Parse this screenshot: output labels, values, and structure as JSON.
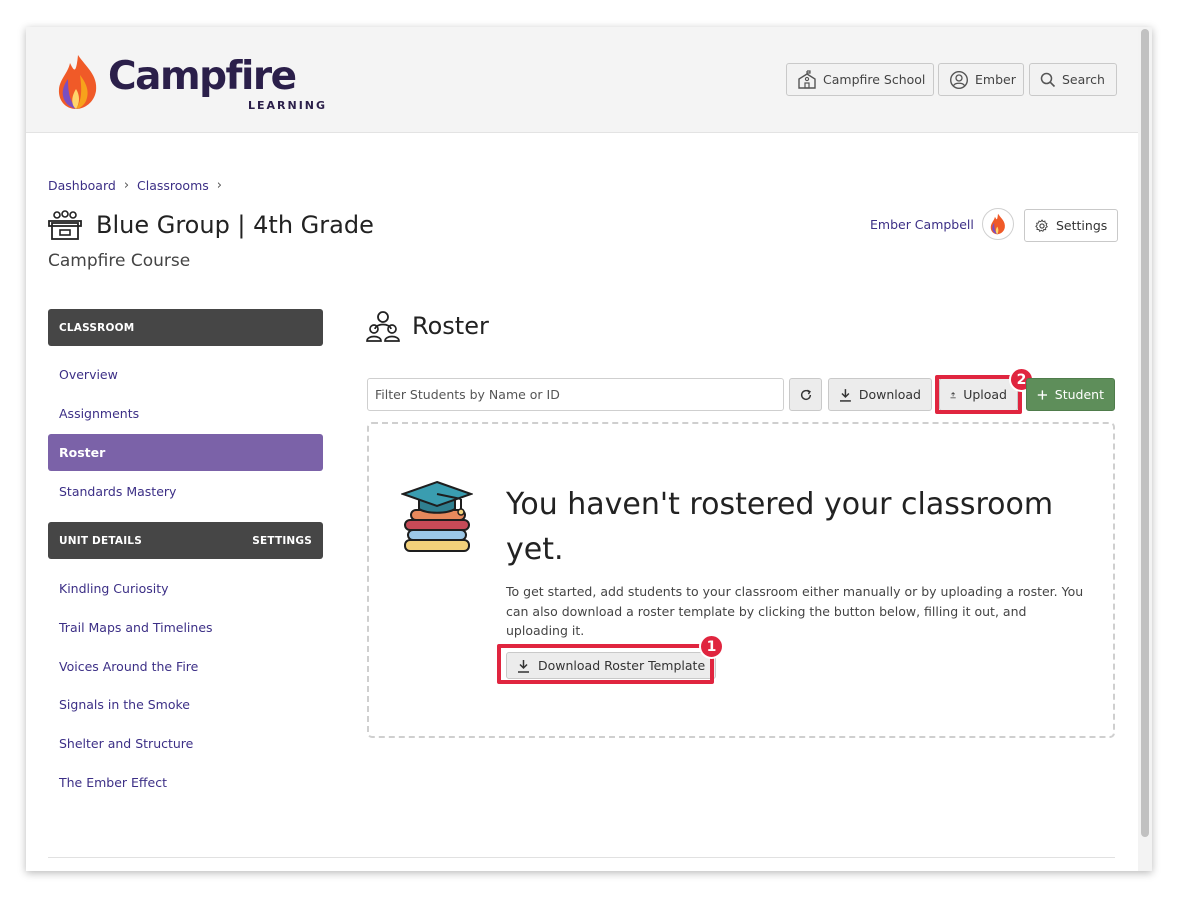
{
  "brand": {
    "name": "Campfire",
    "sub": "LEARNING",
    "colors": {
      "primary": "#2b1f4a",
      "accent_purple": "#7b62a8",
      "link": "#3c2f86",
      "highlight": "#e0253f",
      "success": "#5e8e5a"
    }
  },
  "header": {
    "school_label": "Campfire School",
    "user_label": "Ember",
    "search_label": "Search"
  },
  "breadcrumb": [
    "Dashboard",
    "Classrooms"
  ],
  "classroom": {
    "title": "Blue Group | 4th Grade",
    "course": "Campfire Course",
    "teacher": "Ember Campbell",
    "settings_label": "Settings"
  },
  "sidebar": {
    "classroom_heading": "CLASSROOM",
    "classroom_items": [
      {
        "label": "Overview",
        "active": false
      },
      {
        "label": "Assignments",
        "active": false
      },
      {
        "label": "Roster",
        "active": true
      },
      {
        "label": "Standards Mastery",
        "active": false
      }
    ],
    "unit_heading": "UNIT DETAILS",
    "unit_settings": "SETTINGS",
    "unit_items": [
      {
        "label": "Kindling Curiosity"
      },
      {
        "label": "Trail Maps and Timelines"
      },
      {
        "label": "Voices Around the Fire"
      },
      {
        "label": "Signals in the Smoke"
      },
      {
        "label": "Shelter and Structure"
      },
      {
        "label": "The Ember Effect"
      }
    ]
  },
  "roster": {
    "title": "Roster",
    "filter_placeholder": "Filter Students by Name or ID",
    "download_label": "Download",
    "upload_label": "Upload",
    "add_student_label": "Student",
    "empty_title": "You haven't rostered your classroom yet.",
    "empty_text": "To get started, add students to your classroom either manually or by uploading a roster. You can also download a roster template by clicking the button below, filling it out, and uploading it.",
    "template_button": "Download Roster Template"
  },
  "callouts": {
    "first": "1",
    "second": "2"
  },
  "icons": [
    "campfire-logo",
    "school-icon",
    "user-circle-icon",
    "search-icon",
    "classroom-icon",
    "gear-icon",
    "users-icon",
    "refresh-icon",
    "download-icon",
    "upload-icon",
    "plus-icon",
    "graduation-books-icon"
  ]
}
